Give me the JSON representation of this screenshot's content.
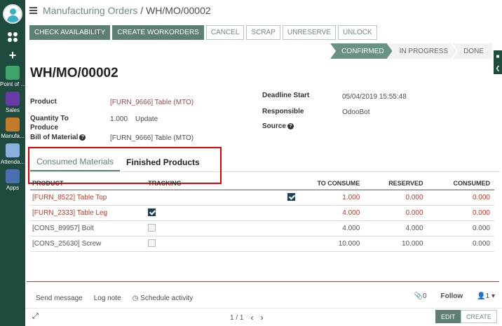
{
  "breadcrumb": {
    "parent": "Manufacturing Orders",
    "separator": "/",
    "current": "WH/MO/00002"
  },
  "sidebar": {
    "apps": [
      {
        "label": "Point of ...",
        "icon": "point-of-sale-icon",
        "color": "#3fa46a"
      },
      {
        "label": "Sales",
        "icon": "sales-icon",
        "color": "#6a3aa7"
      },
      {
        "label": "Manufa...",
        "icon": "manufacturing-icon",
        "color": "#c47a2a"
      },
      {
        "label": "Attenda...",
        "icon": "attendance-icon",
        "color": "#8ab0e0"
      },
      {
        "label": "Apps",
        "icon": "apps-icon",
        "color": "#4a6fb0"
      }
    ]
  },
  "toolbar": {
    "check_availability": "CHECK AVAILABILITY",
    "create_workorders": "CREATE WORKORDERS",
    "cancel": "CANCEL",
    "scrap": "SCRAP",
    "unreserve": "UNRESERVE",
    "unlock": "UNLOCK"
  },
  "stages": {
    "confirmed": "CONFIRMED",
    "in_progress": "IN PROGRESS",
    "done": "DONE"
  },
  "form": {
    "title": "WH/MO/00002",
    "product_label": "Product",
    "product_value": "[FURN_9666] Table (MTO)",
    "qty_label_1": "Quantity To",
    "qty_label_2": "Produce",
    "qty_value": "1.000",
    "qty_update": "Update",
    "bom_label": "Bill of Material",
    "bom_value": "[FURN_9666] Table (MTO)",
    "deadline_label": "Deadline Start",
    "deadline_value": "05/04/2019 15:55:48",
    "responsible_label": "Responsible",
    "responsible_value": "OdooBot",
    "source_label": "Source"
  },
  "tabs": {
    "consumed": "Consumed Materials",
    "finished": "Finished Products"
  },
  "table": {
    "headers": {
      "product": "PRODUCT",
      "tracking": "TRACKING",
      "to_consume": "TO CONSUME",
      "reserved": "RESERVED",
      "consumed": "CONSUMED"
    },
    "rows": [
      {
        "product": "[FURN_8522] Table Top",
        "tracking": true,
        "to_consume": "1.000",
        "reserved": "0.000",
        "consumed": "0.000"
      },
      {
        "product": "[FURN_2333] Table Leg",
        "tracking": true,
        "to_consume": "4.000",
        "reserved": "0.000",
        "consumed": "0.000"
      },
      {
        "product": "[CONS_89957] Bolt",
        "tracking": false,
        "to_consume": "4.000",
        "reserved": "4.000",
        "consumed": "0.000"
      },
      {
        "product": "[CONS_25630] Screw",
        "tracking": false,
        "to_consume": "10.000",
        "reserved": "10.000",
        "consumed": "0.000"
      }
    ]
  },
  "chatter": {
    "send_message": "Send message",
    "log_note": "Log note",
    "schedule_activity": "Schedule activity",
    "attachments_count": "0",
    "follow": "Follow",
    "followers_count": "1"
  },
  "pager": {
    "value": "1 / 1"
  },
  "bottom": {
    "edit": "EDIT",
    "create": "CREATE"
  },
  "colors": {
    "sidebar": "#1e4b3d",
    "primary": "#5e7f74",
    "link": "#8a4e4e",
    "highlight": "#e00000"
  }
}
